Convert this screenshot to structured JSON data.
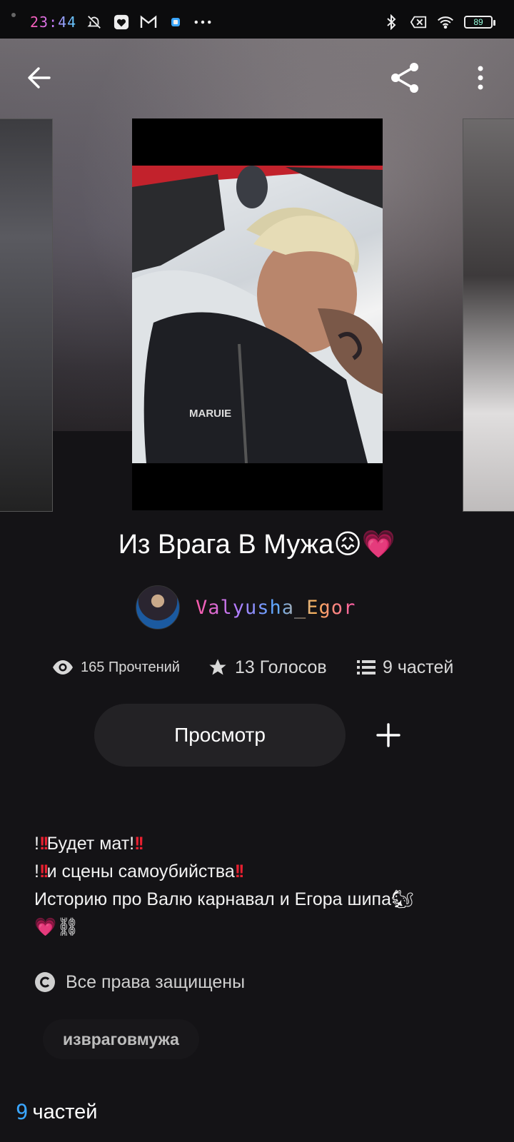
{
  "status_bar": {
    "time": "23:44",
    "battery": "89"
  },
  "toolbar": {
    "back_icon": "arrow-left-icon",
    "share_icon": "share-icon",
    "more_icon": "more-vertical-icon"
  },
  "story": {
    "title": "Из Врага В Мужа😖💗",
    "author": "Valyusha_Egor",
    "stats": {
      "reads": "165 Прочтений",
      "votes": "13 Голосов",
      "parts": "9 частей"
    },
    "view_button": "Просмотр",
    "description": {
      "line1_text": "Будет мат!",
      "line2_text": "и сцены самоубийства",
      "line3": "Историю про Валю карнавал и Егора шипа🐿",
      "line4": "💗⛓"
    },
    "rights": "Все права защищены",
    "tag": "извраговмужа",
    "parts_count": "9",
    "parts_label": "частей"
  }
}
